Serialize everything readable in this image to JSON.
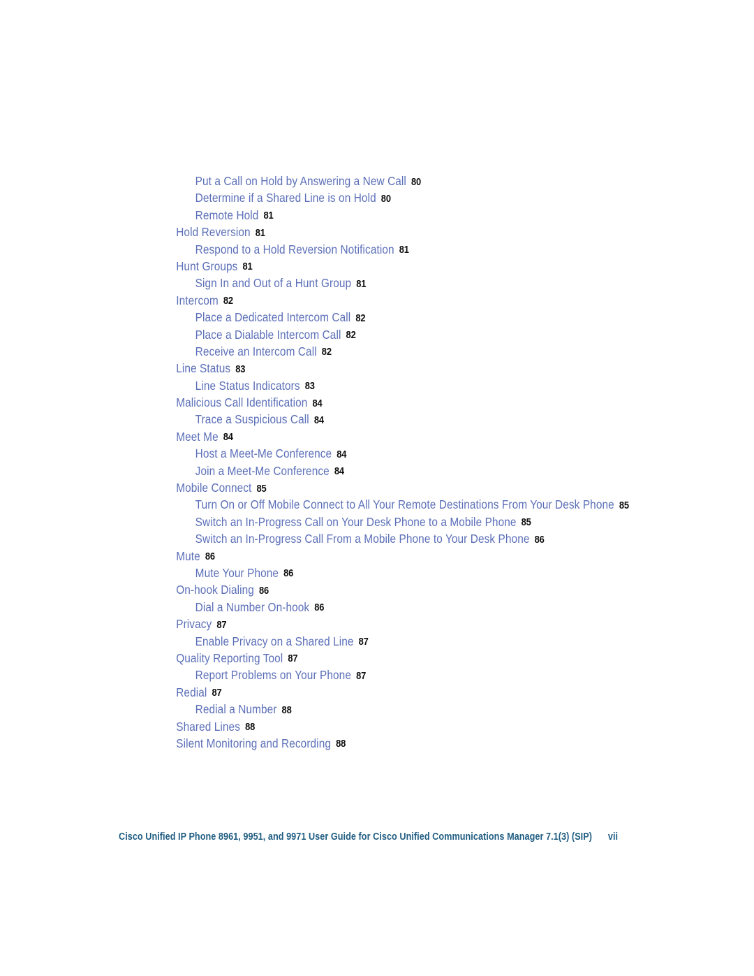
{
  "document": {
    "type": "table-of-contents",
    "page_label": "vii"
  },
  "toc": {
    "entries": [
      {
        "level": 2,
        "title": "Put a Call on Hold by Answering a New Call",
        "page": "80"
      },
      {
        "level": 2,
        "title": "Determine if a Shared Line is on Hold",
        "page": "80"
      },
      {
        "level": 2,
        "title": "Remote Hold",
        "page": "81"
      },
      {
        "level": 1,
        "title": "Hold Reversion",
        "page": "81"
      },
      {
        "level": 2,
        "title": "Respond to a Hold Reversion Notification",
        "page": "81"
      },
      {
        "level": 1,
        "title": "Hunt Groups",
        "page": "81"
      },
      {
        "level": 2,
        "title": "Sign In and Out of a Hunt Group",
        "page": "81"
      },
      {
        "level": 1,
        "title": "Intercom",
        "page": "82"
      },
      {
        "level": 2,
        "title": "Place a Dedicated Intercom Call",
        "page": "82"
      },
      {
        "level": 2,
        "title": "Place a Dialable Intercom Call",
        "page": "82"
      },
      {
        "level": 2,
        "title": "Receive an Intercom Call",
        "page": "82"
      },
      {
        "level": 1,
        "title": "Line Status",
        "page": "83"
      },
      {
        "level": 2,
        "title": "Line Status Indicators",
        "page": "83"
      },
      {
        "level": 1,
        "title": "Malicious Call Identification",
        "page": "84"
      },
      {
        "level": 2,
        "title": "Trace a Suspicious Call",
        "page": "84"
      },
      {
        "level": 1,
        "title": "Meet Me",
        "page": "84"
      },
      {
        "level": 2,
        "title": "Host a Meet-Me Conference",
        "page": "84"
      },
      {
        "level": 2,
        "title": "Join a Meet-Me Conference",
        "page": "84"
      },
      {
        "level": 1,
        "title": "Mobile Connect",
        "page": "85"
      },
      {
        "level": 2,
        "title": "Turn On or Off Mobile Connect to All Your Remote Destinations From Your Desk Phone",
        "page": "85"
      },
      {
        "level": 2,
        "title": "Switch an In-Progress Call on Your Desk Phone to a Mobile Phone",
        "page": "85"
      },
      {
        "level": 2,
        "title": "Switch an In-Progress Call From a Mobile Phone to Your Desk Phone",
        "page": "86"
      },
      {
        "level": 1,
        "title": "Mute",
        "page": "86"
      },
      {
        "level": 2,
        "title": "Mute Your Phone",
        "page": "86"
      },
      {
        "level": 1,
        "title": "On-hook Dialing",
        "page": "86"
      },
      {
        "level": 2,
        "title": "Dial a Number On-hook",
        "page": "86"
      },
      {
        "level": 1,
        "title": "Privacy",
        "page": "87"
      },
      {
        "level": 2,
        "title": "Enable Privacy on a Shared Line",
        "page": "87"
      },
      {
        "level": 1,
        "title": "Quality Reporting Tool",
        "page": "87"
      },
      {
        "level": 2,
        "title": "Report Problems on Your Phone",
        "page": "87"
      },
      {
        "level": 1,
        "title": "Redial",
        "page": "87"
      },
      {
        "level": 2,
        "title": "Redial a Number",
        "page": "88"
      },
      {
        "level": 1,
        "title": "Shared Lines",
        "page": "88"
      },
      {
        "level": 1,
        "title": "Silent Monitoring and Recording",
        "page": "88"
      }
    ]
  },
  "footer": {
    "text": "Cisco Unified IP Phone 8961, 9951, and 9971 User Guide for Cisco Unified Communications Manager 7.1(3) (SIP)",
    "folio": "vii"
  },
  "colors": {
    "toc_entry": "#5B6FB8",
    "page_number": "#100F10",
    "footer": "#215E83",
    "background": "#FFFFFF"
  }
}
